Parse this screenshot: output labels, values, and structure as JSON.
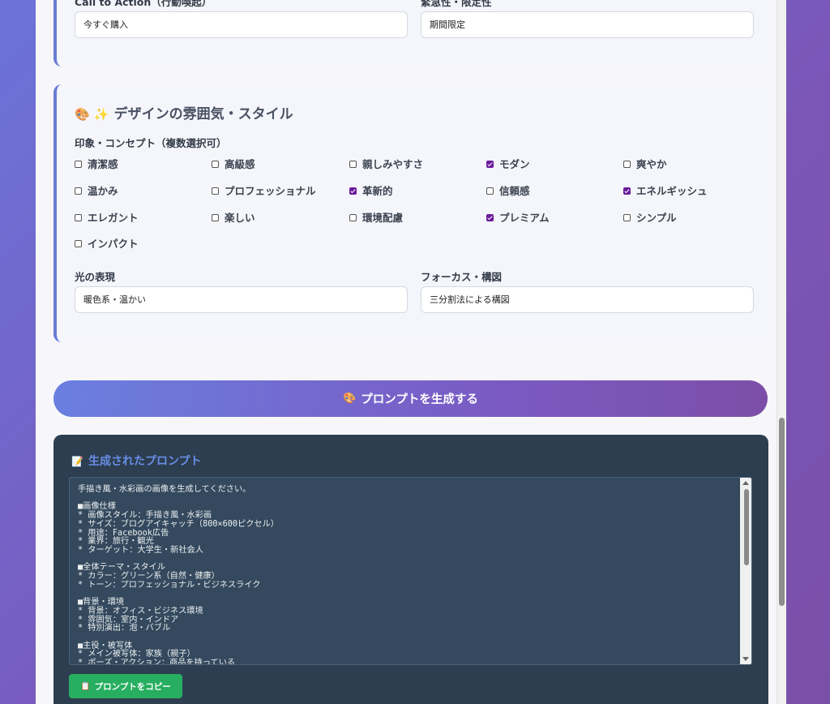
{
  "section_cta": {
    "cta_label": "Call to Action（行動喚起）",
    "cta_value": "今すぐ購入",
    "urgency_label": "緊急性・限定性",
    "urgency_value": "期間限定"
  },
  "section_design": {
    "title_icons": "🎨 ✨",
    "title": "デザインの雰囲気・スタイル",
    "concept_label": "印象・コンセプト（複数選択可）",
    "checkboxes": [
      {
        "label": "清潔感",
        "checked": false
      },
      {
        "label": "高級感",
        "checked": false
      },
      {
        "label": "親しみやすさ",
        "checked": false
      },
      {
        "label": "モダン",
        "checked": true
      },
      {
        "label": "爽やか",
        "checked": false
      },
      {
        "label": "温かみ",
        "checked": false
      },
      {
        "label": "プロフェッショナル",
        "checked": false
      },
      {
        "label": "革新的",
        "checked": true
      },
      {
        "label": "信頼感",
        "checked": false
      },
      {
        "label": "エネルギッシュ",
        "checked": true
      },
      {
        "label": "エレガント",
        "checked": false
      },
      {
        "label": "楽しい",
        "checked": false
      },
      {
        "label": "環境配慮",
        "checked": false
      },
      {
        "label": "プレミアム",
        "checked": true
      },
      {
        "label": "シンプル",
        "checked": false
      },
      {
        "label": "インパクト",
        "checked": false
      }
    ],
    "light_label": "光の表現",
    "light_value": "暖色系・温かい",
    "focus_label": "フォーカス・構図",
    "focus_value": "三分割法による構図"
  },
  "generate_button": {
    "icon": "🎨",
    "label": "プロンプトを生成する"
  },
  "result": {
    "icon": "📝",
    "title": "生成されたプロンプト",
    "text": "手描き風・水彩画の画像を生成してください。\n\n■画像仕様\n* 画像スタイル：手描き風・水彩画\n* サイズ：ブログアイキャッチ（800×600ピクセル）\n* 用途：Facebook広告\n* 業界：旅行・観光\n* ターゲット：大学生・新社会人\n\n■全体テーマ・スタイル\n* カラー：グリーン系（自然・健康）\n* トーン：プロフェッショナル・ビジネスライク\n\n■背景・環境\n* 背景：オフィス・ビジネス環境\n* 雰囲気：室内・インドア\n* 特別演出：泡・バブル\n\n■主役・被写体\n* メイン被写体：家族（親子）\n* ポーズ・アクション：商品を持っている",
    "copy_icon": "📋",
    "copy_label": "プロンプトをコピー"
  }
}
